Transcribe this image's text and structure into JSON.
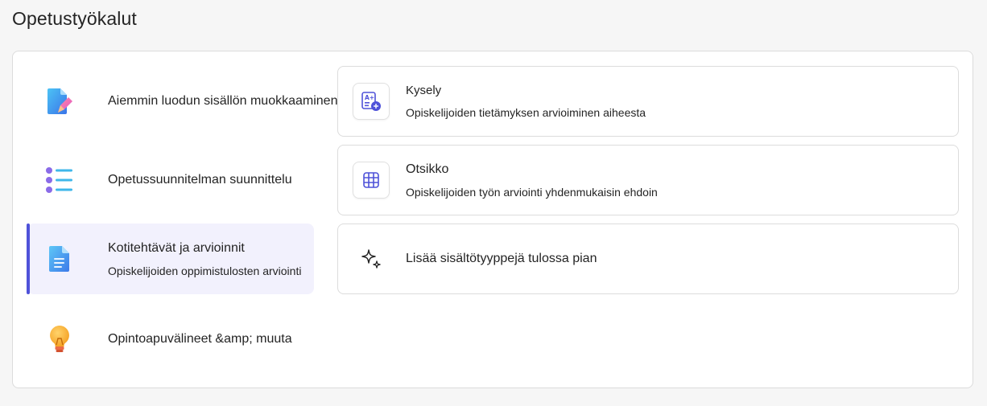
{
  "page": {
    "title": "Opetustyökalut"
  },
  "categories": [
    {
      "title": "Aiemmin luodun sisällön muokkaaminen",
      "icon": "document-edit-icon"
    },
    {
      "title": "Opetussuunnitelman suunnittelu",
      "icon": "list-icon"
    },
    {
      "title": "Kotitehtävät ja arvioinnit",
      "subtitle": "Opiskelijoiden oppimistulosten arviointi",
      "icon": "document-icon",
      "active": true
    },
    {
      "title": "Opintoapuvälineet &amp; muuta",
      "icon": "lightbulb-icon"
    }
  ],
  "cards": [
    {
      "title": "Kysely",
      "subtitle": "Opiskelijoiden tietämyksen arvioiminen aiheesta",
      "icon": "quiz-icon"
    },
    {
      "title": "Otsikko",
      "subtitle": "Opiskelijoiden työn arviointi yhdenmukaisin ehdoin",
      "icon": "table-grid-icon"
    },
    {
      "title": "Lisää sisältötyyppejä tulossa pian",
      "icon": "sparkle-icon"
    }
  ],
  "colors": {
    "accent": "#4f52d9",
    "active_bg": "#f2f1fd"
  }
}
